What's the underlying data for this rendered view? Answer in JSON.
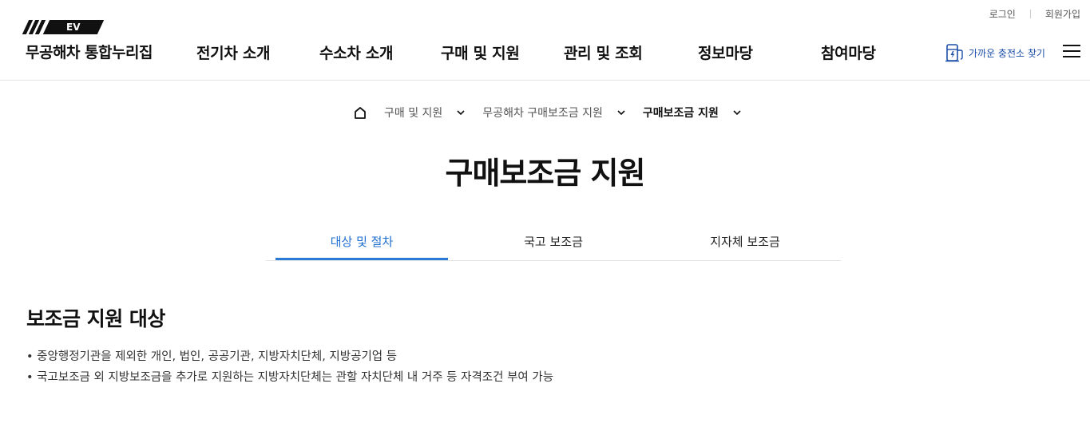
{
  "header": {
    "util": {
      "login": "로그인",
      "signup": "회원가입"
    },
    "logo": {
      "badge": "EV",
      "title": "무공해차 통합누리집"
    },
    "nav": [
      {
        "label": "전기차 소개"
      },
      {
        "label": "수소차 소개"
      },
      {
        "label": "구매 및 지원"
      },
      {
        "label": "관리 및 조회"
      },
      {
        "label": "정보마당"
      },
      {
        "label": "참여마당"
      }
    ],
    "charge_label": "가까운 충전소 찾기",
    "accent": "#1c4fa8"
  },
  "breadcrumb": {
    "items": [
      "구매 및 지원",
      "무공해차 구매보조금 지원",
      "구매보조금 지원"
    ]
  },
  "page": {
    "title": "구매보조금 지원"
  },
  "tabs": {
    "items": [
      "대상 및 절차",
      "국고 보조금",
      "지자체 보조금"
    ],
    "active": 0,
    "active_color": "#1f6fd1"
  },
  "content": {
    "section_title": "보조금 지원 대상",
    "bullets": [
      "중앙행정기관을 제외한 개인, 법인, 공공기관, 지방자치단체, 지방공기업 등",
      "국고보조금 외 지방보조금을 추가로 지원하는 지방자치단체는 관할 자치단체 내 거주 등 자격조건 부여 가능"
    ]
  }
}
